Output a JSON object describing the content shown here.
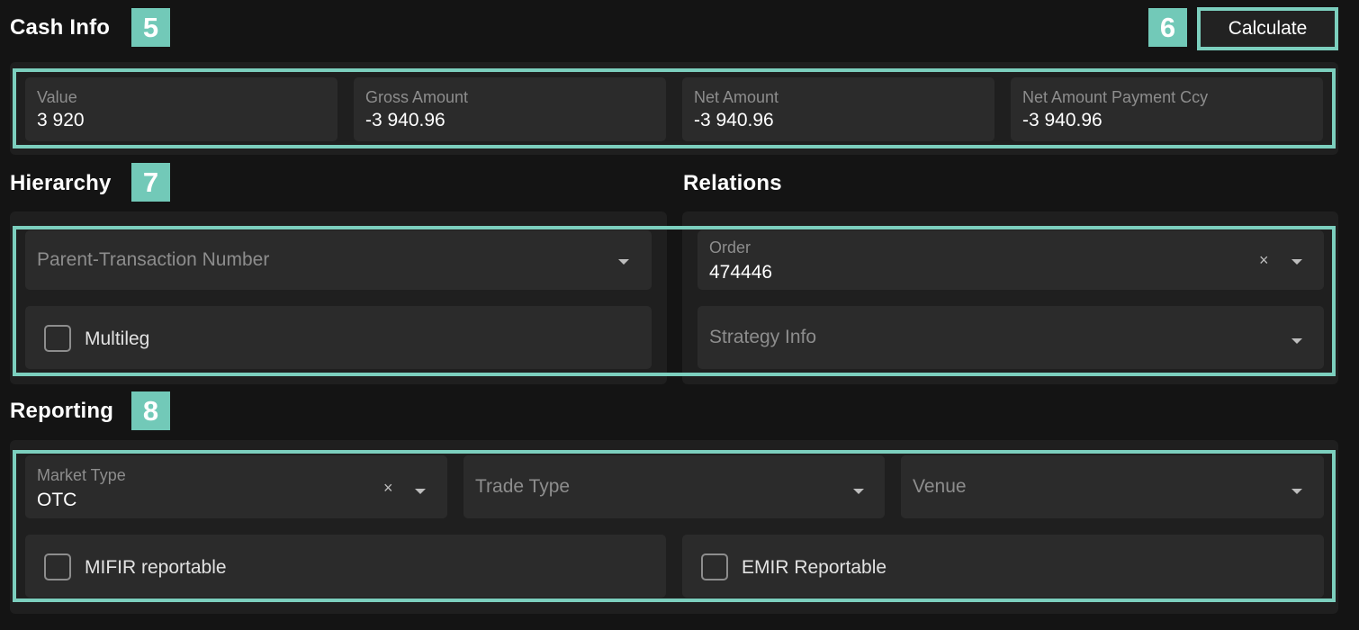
{
  "cash_info": {
    "title": "Cash Info",
    "badge": "5",
    "calculate_badge": "6",
    "calculate_label": "Calculate",
    "fields": [
      {
        "label": "Value",
        "value": "3 920"
      },
      {
        "label": "Gross Amount",
        "value": "-3 940.96"
      },
      {
        "label": "Net Amount",
        "value": "-3 940.96"
      },
      {
        "label": "Net Amount Payment Ccy",
        "value": "-3 940.96"
      }
    ]
  },
  "hierarchy": {
    "title": "Hierarchy",
    "badge": "7",
    "parent_placeholder": "Parent-Transaction Number",
    "multileg_label": "Multileg"
  },
  "relations": {
    "title": "Relations",
    "order_label": "Order",
    "order_value": "474446",
    "strategy_placeholder": "Strategy Info"
  },
  "reporting": {
    "title": "Reporting",
    "badge": "8",
    "market_type_label": "Market Type",
    "market_type_value": "OTC",
    "trade_type_placeholder": "Trade Type",
    "venue_placeholder": "Venue",
    "mifir_label": "MIFIR reportable",
    "emir_label": "EMIR Reportable"
  },
  "icons": {
    "clear": "close-icon",
    "dropdown": "chevron-down-icon"
  },
  "colors": {
    "accent": "#7ccfbe",
    "badge": "#72c9b8",
    "background": "#141414",
    "panel": "#1f1f1f",
    "field": "#2b2b2b"
  }
}
